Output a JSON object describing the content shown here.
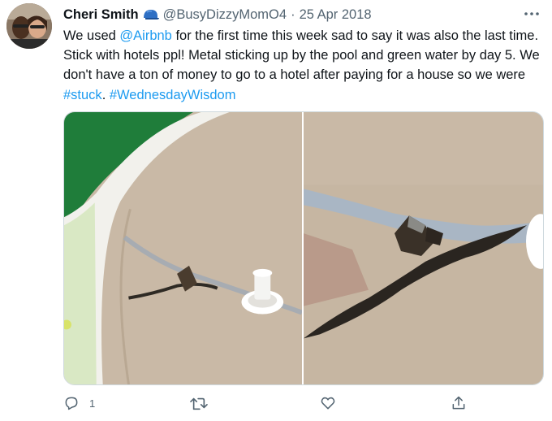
{
  "tweet": {
    "author_name": "Cheri Smith",
    "handle": "@BusyDizzyMomO4",
    "separator": "·",
    "date": "25 Apr 2018",
    "text_parts": {
      "p1": "We used ",
      "mention": "@Airbnb",
      "p2": " for the first time this week sad to say it was also the last time. Stick with hotels ppl! Metal sticking up by the pool and green water by day 5. We don't have a ton of money to go to a hotel after paying for a house so we were ",
      "hashtag1": "#stuck",
      "p3": ". ",
      "hashtag2": "#WednesdayWisdom"
    },
    "reply_count": "1",
    "icons": {
      "verified": "blue-cap-emoji-icon",
      "more": "more-dots-icon",
      "reply": "reply-icon",
      "retweet": "retweet-icon",
      "like": "like-icon",
      "share": "share-icon"
    },
    "colors": {
      "text": "#0f1419",
      "muted": "#536471",
      "link": "#1d9bf0"
    }
  }
}
